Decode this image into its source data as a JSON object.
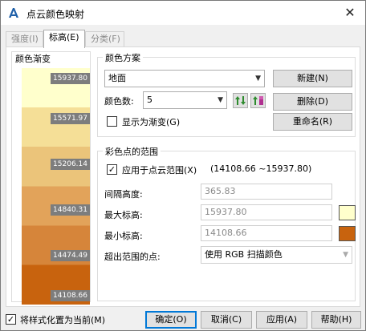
{
  "window": {
    "title": "点云颜色映射",
    "close_glyph": "✕"
  },
  "tabs": [
    {
      "label": "强度(I)",
      "active": false
    },
    {
      "label": "标高(E)",
      "active": true
    },
    {
      "label": "分类(F)",
      "active": false
    }
  ],
  "gradient": {
    "title": "颜色渐变",
    "colors": [
      "#ffffcc",
      "#f5df97",
      "#ebc47a",
      "#e2a35a",
      "#d6853a",
      "#c8630e"
    ],
    "ticks": [
      "15937.80",
      "15571.97",
      "15206.14",
      "14840.31",
      "14474.49",
      "14108.66"
    ]
  },
  "scheme": {
    "title": "颜色方案",
    "selected": "地面",
    "count_label": "颜色数:",
    "count_value": "5",
    "show_gradient_label": "显示为渐变(G)",
    "show_gradient_checked": false,
    "new_label": "新建(N)",
    "delete_label": "删除(D)",
    "rename_label": "重命名(R)"
  },
  "range": {
    "title": "彩色点的范围",
    "apply_label": "应用于点云范围(X)",
    "apply_range_text": "(14108.66 ~15937.80)",
    "apply_checked": true,
    "interval_label": "间隔高度:",
    "interval_value": "365.83",
    "max_label": "最大标高:",
    "max_value": "15937.80",
    "max_color": "#ffffcc",
    "min_label": "最小标高:",
    "min_value": "14108.66",
    "min_color": "#c8630e",
    "out_label": "超出范围的点:",
    "out_value": "使用 RGB 扫描颜色"
  },
  "footer": {
    "set_current_label": "将样式化置为当前(M)",
    "set_current_checked": true,
    "ok_label": "确定(O)",
    "cancel_label": "取消(C)",
    "apply_label": "应用(A)",
    "help_label": "帮助(H)"
  }
}
